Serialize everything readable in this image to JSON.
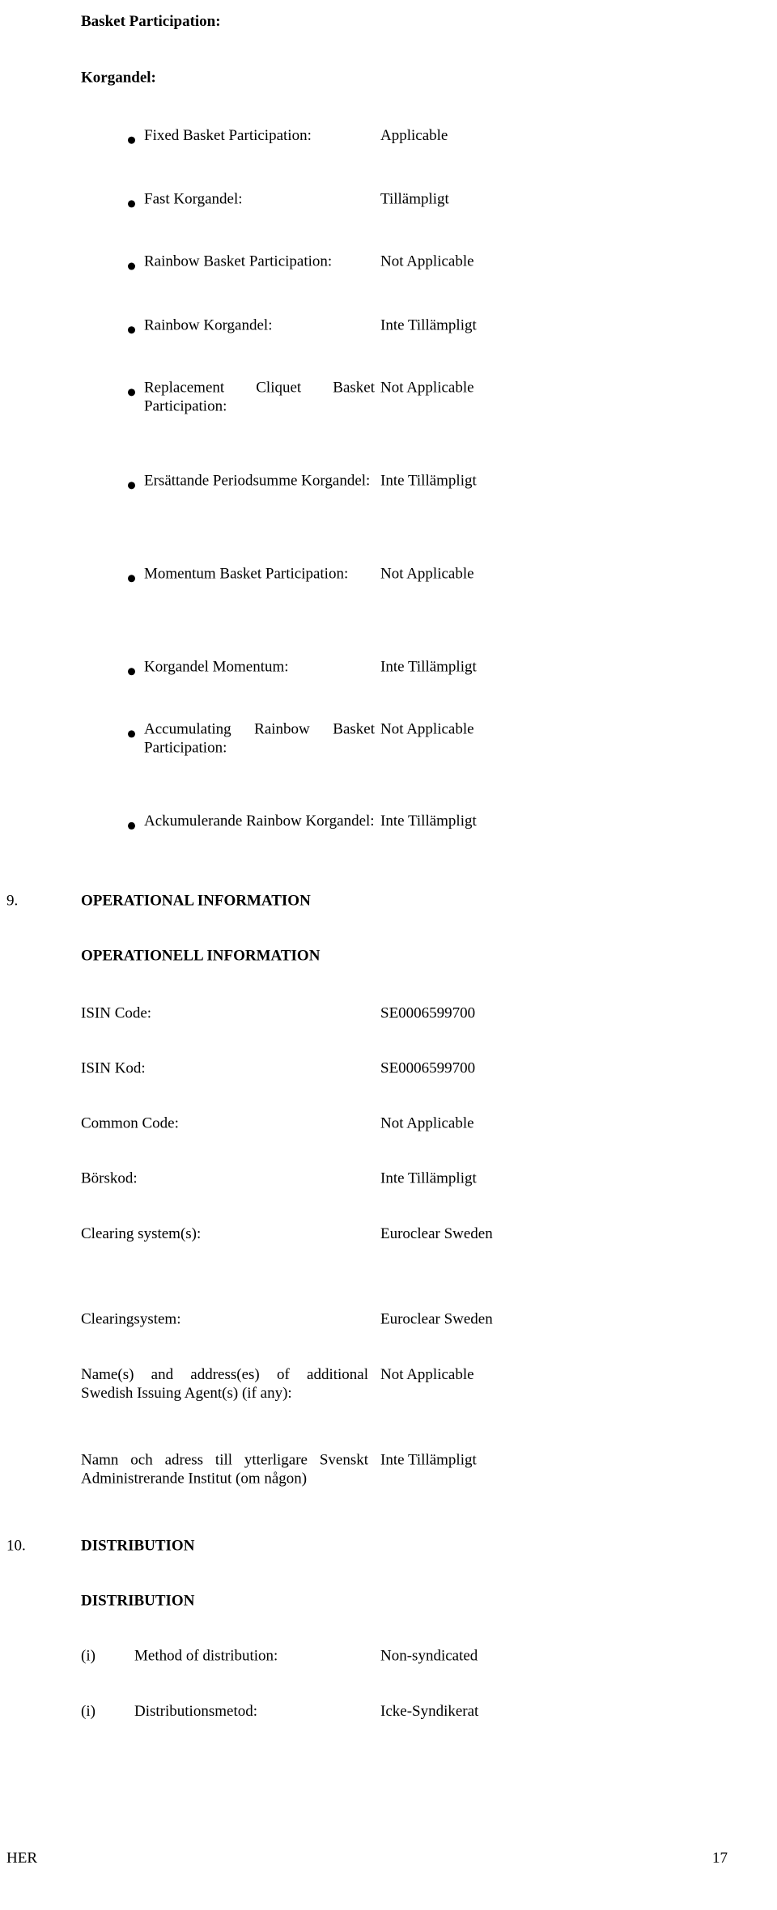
{
  "document": {
    "headings": {
      "basket_participation_en": "Basket Participation:",
      "basket_participation_sv": "Korgandel:"
    },
    "basket_items": [
      {
        "label": "Fixed Basket Participation:",
        "value": "Applicable"
      },
      {
        "label": "Fast Korgandel:",
        "value": "Tillämpligt"
      },
      {
        "label": "Rainbow Basket Participation:",
        "value": "Not Applicable"
      },
      {
        "label": "Rainbow Korgandel:",
        "value": "Inte Tillämpligt"
      },
      {
        "label": "Replacement Cliquet Basket Participation:",
        "value": "Not Applicable"
      },
      {
        "label": "Ersättande Periodsumme Korgandel:",
        "value": "Inte Tillämpligt"
      },
      {
        "label": "Momentum Basket Participation:",
        "value": "Not Applicable"
      },
      {
        "label": "Korgandel Momentum:",
        "value": "Inte Tillämpligt"
      },
      {
        "label": "Accumulating Rainbow Basket Participation:",
        "value": "Not Applicable"
      },
      {
        "label": "Ackumulerande Rainbow Korgandel:",
        "value": "Inte Tillämpligt"
      }
    ],
    "section9": {
      "number": "9.",
      "title_en": "OPERATIONAL INFORMATION",
      "title_sv": "OPERATIONELL INFORMATION",
      "rows": [
        {
          "label": "ISIN Code:",
          "value": "SE0006599700"
        },
        {
          "label": "ISIN Kod:",
          "value": "SE0006599700"
        },
        {
          "label": "Common Code:",
          "value": "Not Applicable"
        },
        {
          "label": "Börskod:",
          "value": "Inte Tillämpligt"
        },
        {
          "label": "Clearing system(s):",
          "value": "Euroclear Sweden"
        },
        {
          "label": "Clearingsystem:",
          "value": "Euroclear Sweden"
        },
        {
          "label": "Name(s) and address(es) of additional Swedish Issuing Agent(s) (if any):",
          "value": "Not Applicable"
        },
        {
          "label": "Namn och adress till ytterligare Svenskt Administrerande Institut (om någon)",
          "value": "Inte Tillämpligt"
        }
      ]
    },
    "section10": {
      "number": "10.",
      "title_en": "DISTRIBUTION",
      "title_sv": "DISTRIBUTION",
      "rows": [
        {
          "marker": "(i)",
          "label": "Method of distribution:",
          "value": "Non-syndicated"
        },
        {
          "marker": "(i)",
          "label": "Distributionsmetod:",
          "value": "Icke-Syndikerat"
        }
      ]
    },
    "footer": {
      "left": "HER",
      "page_number": "17"
    }
  }
}
